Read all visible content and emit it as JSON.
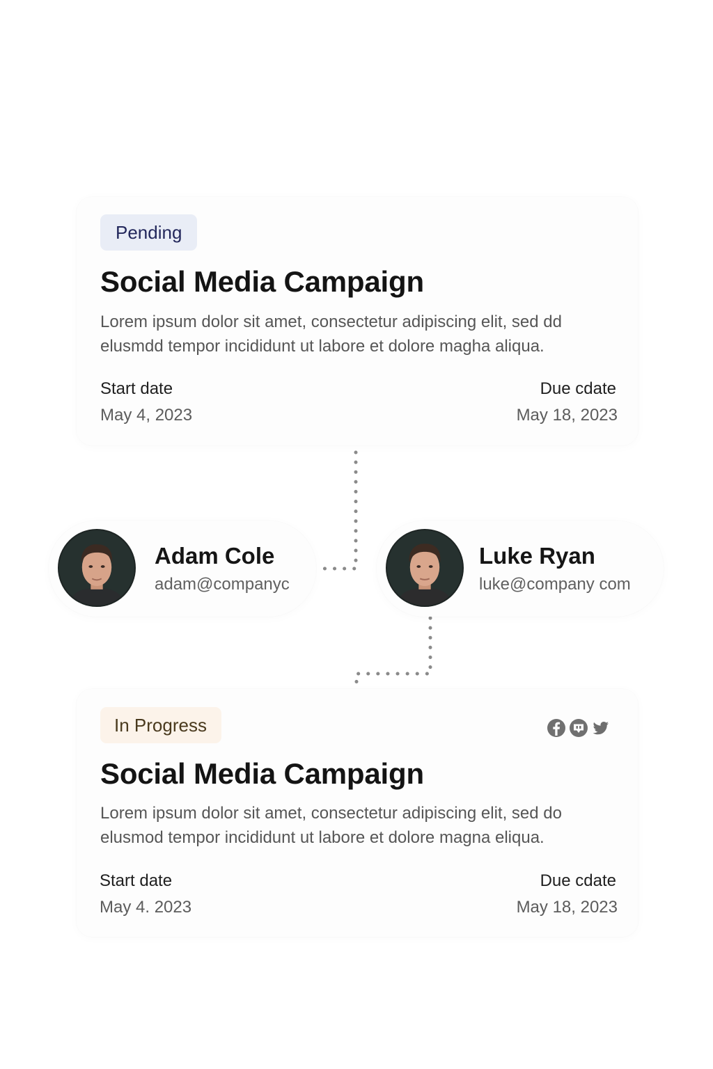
{
  "tasks": [
    {
      "status": "Pending",
      "title": "Social Media Campaign",
      "description": "Lorem ipsum dolor sit amet, consectetur adipiscing elit, sed dd elusmdd tempor incididunt ut labore et dolore magha aliqua.",
      "start_label": "Start date",
      "start_value": "May 4, 2023",
      "due_label": "Due cdate",
      "due_value": "May 18, 2023"
    },
    {
      "status": "In Progress",
      "title": "Social Media Campaign",
      "description": "Lorem ipsum dolor sit amet, consectetur adipiscing elit, sed do elusmod tempor incididunt ut labore et dolore magna eliqua.",
      "start_label": "Start date",
      "start_value": "May 4. 2023",
      "due_label": "Due cdate",
      "due_value": "May 18, 2023",
      "icons": [
        "facebook-icon",
        "chat-icon",
        "twitter-icon"
      ]
    }
  ],
  "people": [
    {
      "name": "Adam Cole",
      "email": "adam@companyc"
    },
    {
      "name": "Luke Ryan",
      "email": "luke@company com"
    }
  ],
  "colors": {
    "pending_bg": "#e9edf6",
    "pending_text": "#23285c",
    "in_progress_bg": "#fcf3ea",
    "in_progress_text": "#4a3a1e",
    "connector": "#8a8a8a"
  }
}
